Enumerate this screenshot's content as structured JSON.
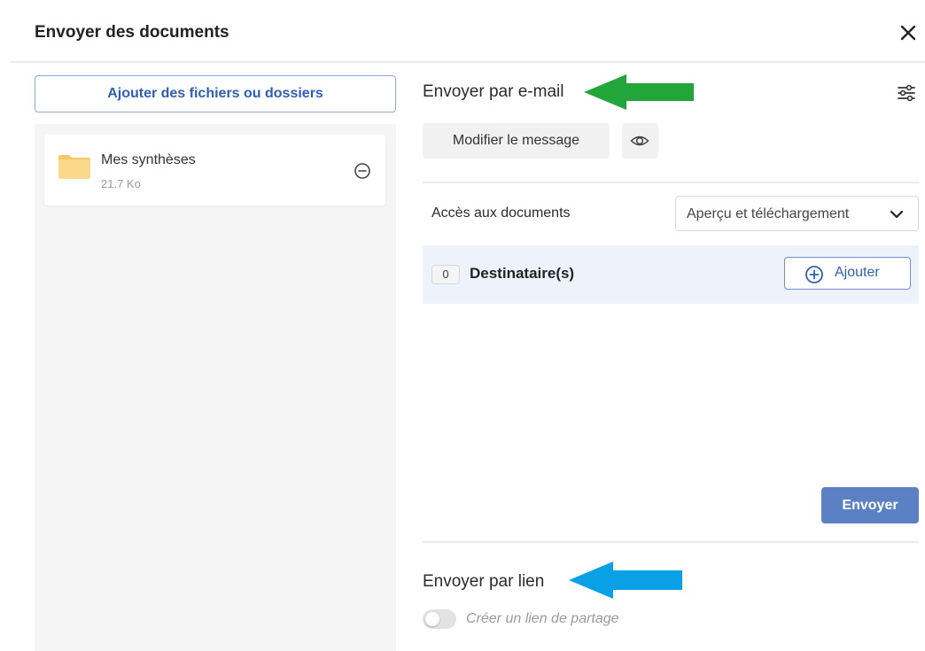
{
  "header": {
    "title": "Envoyer des documents",
    "close_icon": "close-icon"
  },
  "left_panel": {
    "add_files_label": "Ajouter des fichiers ou dossiers",
    "files": [
      {
        "name": "Mes synthèses",
        "size": "21.7 Ko",
        "icon": "folder-icon",
        "action_icon": "remove-icon"
      }
    ]
  },
  "email_section": {
    "title": "Envoyer par e-mail",
    "settings_icon": "settings-sliders-icon",
    "modify_message_label": "Modifier le message",
    "preview_icon": "eye-icon",
    "access_label": "Accès aux documents",
    "access_value": "Aperçu et téléchargement",
    "recipients_count": "0",
    "recipients_label": "Destinataire(s)",
    "add_recipient_label": "Ajouter",
    "send_label": "Envoyer"
  },
  "link_section": {
    "title": "Envoyer par lien",
    "toggle_label": "Créer un lien de partage",
    "toggle_on": false
  },
  "annotations": {
    "green_arrow_color": "#22a63a",
    "blue_arrow_color": "#0aa0e6"
  },
  "colors": {
    "accent": "#2f5fb3",
    "primary_button": "#5b80c4",
    "panel_bg": "#f5f5f5",
    "recipients_bg": "#eef3fb"
  }
}
